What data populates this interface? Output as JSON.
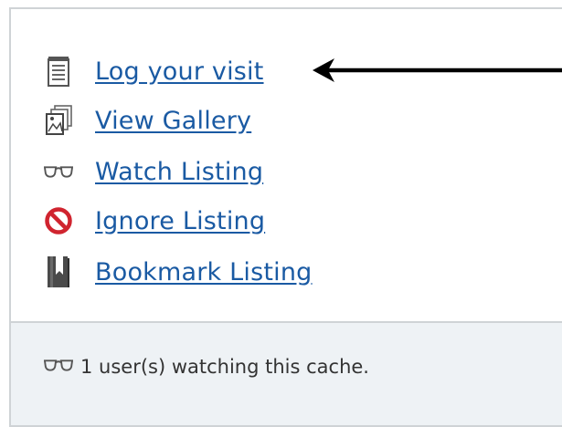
{
  "links": [
    {
      "label": "Log your visit",
      "icon": "notepad-icon"
    },
    {
      "label": "View Gallery",
      "icon": "gallery-icon"
    },
    {
      "label": "Watch Listing",
      "icon": "glasses-icon"
    },
    {
      "label": "Ignore Listing",
      "icon": "prohibited-icon"
    },
    {
      "label": "Bookmark Listing",
      "icon": "bookmark-icon"
    }
  ],
  "footer": {
    "text": "1 user(s) watching this cache.",
    "icon": "glasses-icon"
  },
  "colors": {
    "link": "#1a5aa3",
    "prohibited": "#d0242f",
    "footer_bg": "#eef2f5",
    "border": "#cfd3d6"
  }
}
